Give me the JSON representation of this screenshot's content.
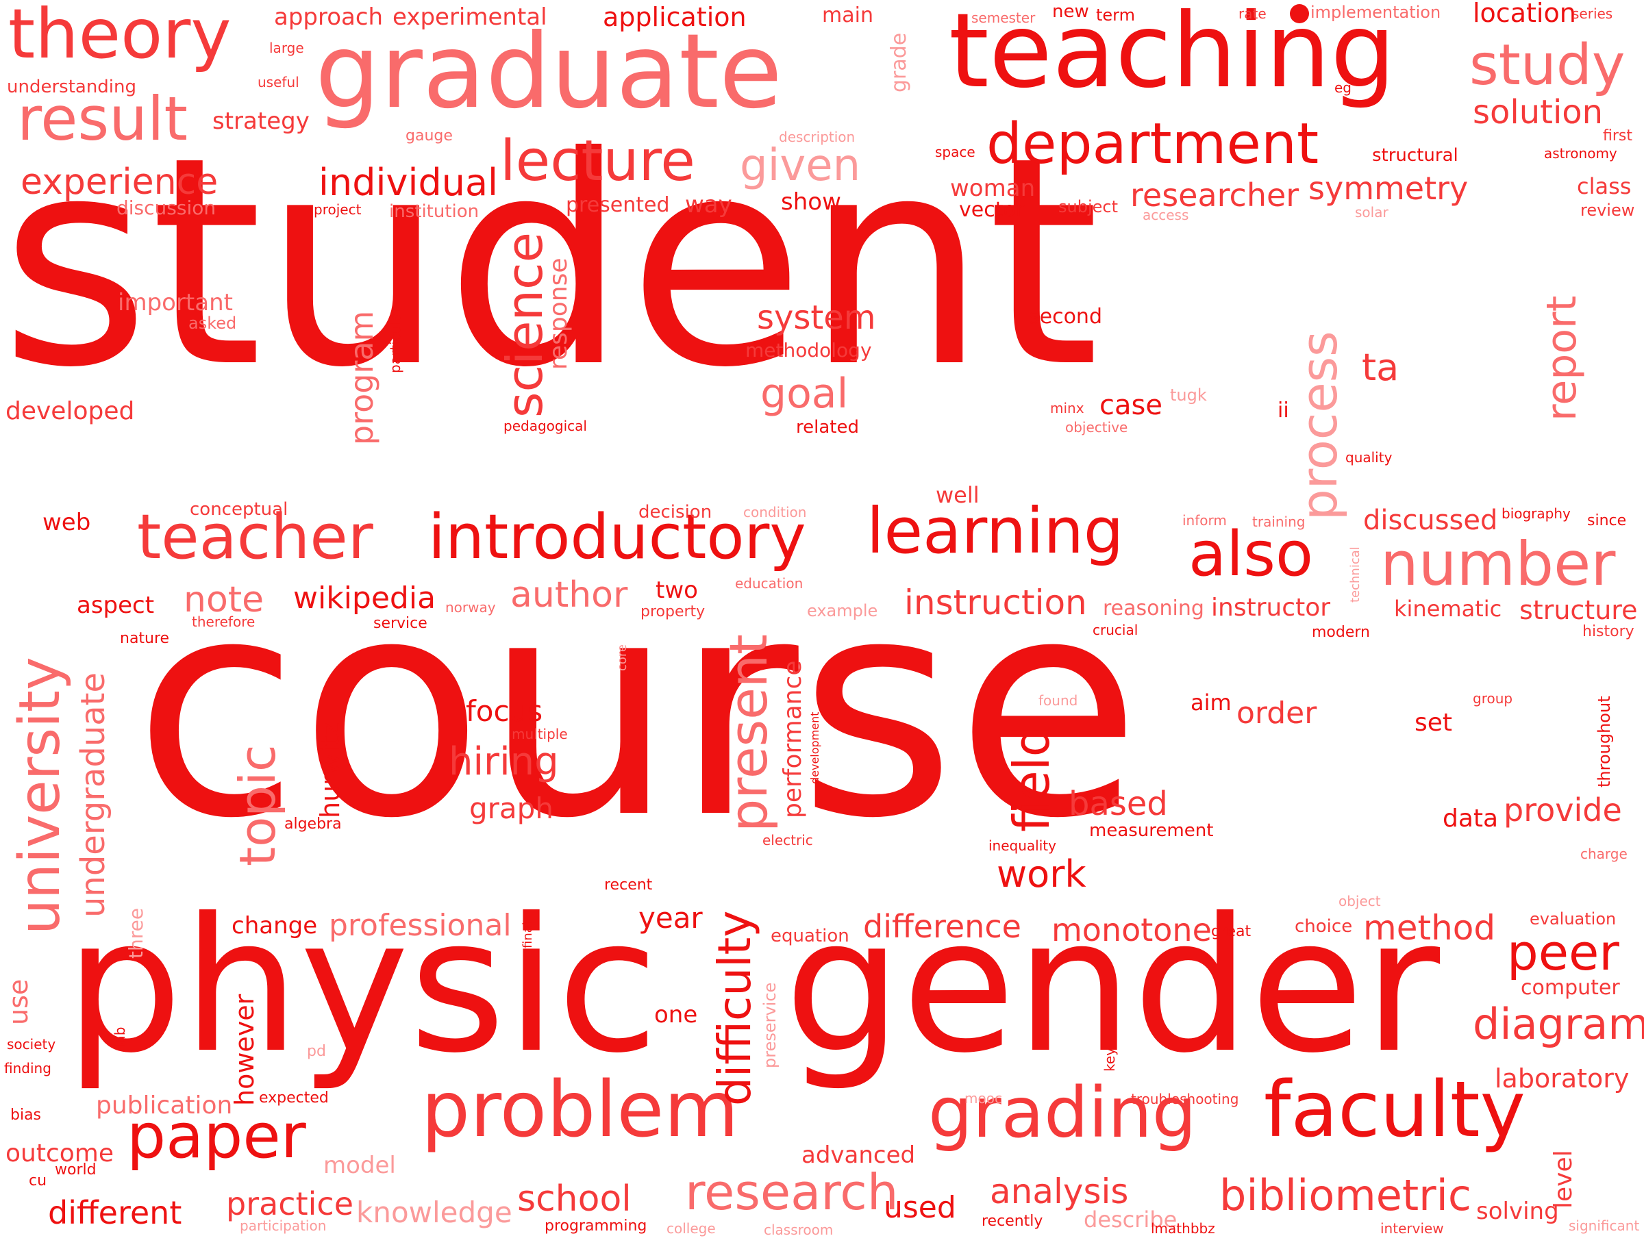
{
  "colors": {
    "strong": "#ee1111",
    "medium": "#f53a3a",
    "light": "#f96b6b",
    "pale": "#fb9a9a",
    "background": "#ffffff"
  },
  "words": [
    {
      "text": "student",
      "weight": 10
    },
    {
      "text": "course",
      "weight": 10
    },
    {
      "text": "physic",
      "weight": 9
    },
    {
      "text": "gender",
      "weight": 9
    },
    {
      "text": "teaching",
      "weight": 8
    },
    {
      "text": "graduate",
      "weight": 8
    },
    {
      "text": "theory",
      "weight": 7
    },
    {
      "text": "result",
      "weight": 6
    },
    {
      "text": "department",
      "weight": 6
    },
    {
      "text": "lecture",
      "weight": 6
    },
    {
      "text": "study",
      "weight": 6
    },
    {
      "text": "teacher",
      "weight": 6
    },
    {
      "text": "introductory",
      "weight": 6
    },
    {
      "text": "learning",
      "weight": 6
    },
    {
      "text": "also",
      "weight": 6
    },
    {
      "text": "number",
      "weight": 6
    },
    {
      "text": "problem",
      "weight": 6
    },
    {
      "text": "grading",
      "weight": 6
    },
    {
      "text": "faculty",
      "weight": 6
    },
    {
      "text": "paper",
      "weight": 6
    },
    {
      "text": "research",
      "weight": 5
    },
    {
      "text": "university",
      "weight": 5
    },
    {
      "text": "science",
      "weight": 5
    },
    {
      "text": "process",
      "weight": 5
    },
    {
      "text": "present",
      "weight": 5
    },
    {
      "text": "topic",
      "weight": 5
    },
    {
      "text": "field",
      "weight": 5
    },
    {
      "text": "difficulty",
      "weight": 5
    },
    {
      "text": "peer",
      "weight": 5
    },
    {
      "text": "diagram",
      "weight": 4
    },
    {
      "text": "bibliometric",
      "weight": 4
    },
    {
      "text": "report",
      "weight": 4
    },
    {
      "text": "given",
      "weight": 4
    },
    {
      "text": "individual",
      "weight": 4
    },
    {
      "text": "experience",
      "weight": 4
    },
    {
      "text": "solution",
      "weight": 4
    },
    {
      "text": "researcher",
      "weight": 4
    },
    {
      "text": "symmetry",
      "weight": 4
    },
    {
      "text": "system",
      "weight": 4
    },
    {
      "text": "goal",
      "weight": 4
    },
    {
      "text": "instruction",
      "weight": 4
    },
    {
      "text": "author",
      "weight": 4
    },
    {
      "text": "note",
      "weight": 4
    },
    {
      "text": "wikipedia",
      "weight": 4
    },
    {
      "text": "hiring",
      "weight": 4
    },
    {
      "text": "focus",
      "weight": 4
    },
    {
      "text": "graph",
      "weight": 4
    },
    {
      "text": "order",
      "weight": 4
    },
    {
      "text": "based",
      "weight": 4
    },
    {
      "text": "work",
      "weight": 4
    },
    {
      "text": "provide",
      "weight": 4
    },
    {
      "text": "method",
      "weight": 4
    },
    {
      "text": "monotone",
      "weight": 4
    },
    {
      "text": "difference",
      "weight": 4
    },
    {
      "text": "professional",
      "weight": 4
    },
    {
      "text": "analysis",
      "weight": 4
    },
    {
      "text": "school",
      "weight": 4
    },
    {
      "text": "practice",
      "weight": 4
    },
    {
      "text": "different",
      "weight": 4
    },
    {
      "text": "knowledge",
      "weight": 4
    },
    {
      "text": "undergraduate",
      "weight": 4
    },
    {
      "text": "program",
      "weight": 4
    },
    {
      "text": "location",
      "weight": 3
    },
    {
      "text": "discussed",
      "weight": 3
    },
    {
      "text": "structure",
      "weight": 3
    },
    {
      "text": "laboratory",
      "weight": 3
    },
    {
      "text": "used",
      "weight": 3
    },
    {
      "text": "outcome",
      "weight": 3
    },
    {
      "text": "publication",
      "weight": 3
    },
    {
      "text": "however",
      "weight": 3
    },
    {
      "text": "approach",
      "weight": 3
    },
    {
      "text": "experimental",
      "weight": 3
    },
    {
      "text": "application",
      "weight": 3
    },
    {
      "text": "strategy",
      "weight": 3
    },
    {
      "text": "important",
      "weight": 3
    },
    {
      "text": "developed",
      "weight": 3
    },
    {
      "text": "response",
      "weight": 3
    },
    {
      "text": "performance",
      "weight": 3
    },
    {
      "text": "instructor",
      "weight": 3
    },
    {
      "text": "reasoning",
      "weight": 3
    },
    {
      "text": "kinematic",
      "weight": 3
    },
    {
      "text": "hurwitz",
      "weight": 3
    },
    {
      "text": "case",
      "weight": 3
    },
    {
      "text": "ta",
      "weight": 3
    },
    {
      "text": "set",
      "weight": 3
    },
    {
      "text": "aim",
      "weight": 3
    },
    {
      "text": "data",
      "weight": 3
    },
    {
      "text": "computer",
      "weight": 3
    },
    {
      "text": "year",
      "weight": 3
    },
    {
      "text": "change",
      "weight": 3
    },
    {
      "text": "one",
      "weight": 3
    },
    {
      "text": "two",
      "weight": 3
    },
    {
      "text": "advanced",
      "weight": 3
    },
    {
      "text": "model",
      "weight": 3
    },
    {
      "text": "class",
      "weight": 3
    },
    {
      "text": "woman",
      "weight": 3
    },
    {
      "text": "show",
      "weight": 3
    },
    {
      "text": "way",
      "weight": 3
    },
    {
      "text": "presented",
      "weight": 3
    },
    {
      "text": "vector",
      "weight": 3
    },
    {
      "text": "second",
      "weight": 3
    },
    {
      "text": "well",
      "weight": 3
    },
    {
      "text": "web",
      "weight": 3
    },
    {
      "text": "aspect",
      "weight": 3
    },
    {
      "text": "measurement",
      "weight": 2
    },
    {
      "text": "solving",
      "weight": 3
    },
    {
      "text": "level",
      "weight": 3
    },
    {
      "text": "describe",
      "weight": 3
    },
    {
      "text": "use",
      "weight": 3
    },
    {
      "text": "main",
      "weight": 3
    },
    {
      "text": "grade",
      "weight": 3
    },
    {
      "text": "new",
      "weight": 2
    },
    {
      "text": "term",
      "weight": 2
    },
    {
      "text": "rate",
      "weight": 2
    },
    {
      "text": "implementation",
      "weight": 2
    },
    {
      "text": "series",
      "weight": 2
    },
    {
      "text": "semester",
      "weight": 2
    },
    {
      "text": "large",
      "weight": 2
    },
    {
      "text": "useful",
      "weight": 2
    },
    {
      "text": "understanding",
      "weight": 2
    },
    {
      "text": "gauge",
      "weight": 2
    },
    {
      "text": "description",
      "weight": 2
    },
    {
      "text": "eg",
      "weight": 2
    },
    {
      "text": "first",
      "weight": 2
    },
    {
      "text": "astronomy",
      "weight": 2
    },
    {
      "text": "structural",
      "weight": 2
    },
    {
      "text": "space",
      "weight": 2
    },
    {
      "text": "discussion",
      "weight": 2
    },
    {
      "text": "project",
      "weight": 2
    },
    {
      "text": "institution",
      "weight": 2
    },
    {
      "text": "subject",
      "weight": 2
    },
    {
      "text": "access",
      "weight": 2
    },
    {
      "text": "solar",
      "weight": 2
    },
    {
      "text": "review",
      "weight": 2
    },
    {
      "text": "asked",
      "weight": 2
    },
    {
      "text": "methodology",
      "weight": 2
    },
    {
      "text": "particular",
      "weight": 2
    },
    {
      "text": "pedagogical",
      "weight": 2
    },
    {
      "text": "related",
      "weight": 2
    },
    {
      "text": "minx",
      "weight": 2
    },
    {
      "text": "objective",
      "weight": 2
    },
    {
      "text": "tugk",
      "weight": 2
    },
    {
      "text": "ii",
      "weight": 2
    },
    {
      "text": "quality",
      "weight": 2
    },
    {
      "text": "conceptual",
      "weight": 2
    },
    {
      "text": "decision",
      "weight": 2
    },
    {
      "text": "condition",
      "weight": 2
    },
    {
      "text": "inform",
      "weight": 2
    },
    {
      "text": "training",
      "weight": 2
    },
    {
      "text": "technical",
      "weight": 2
    },
    {
      "text": "biography",
      "weight": 2
    },
    {
      "text": "since",
      "weight": 2
    },
    {
      "text": "education",
      "weight": 2
    },
    {
      "text": "property",
      "weight": 2
    },
    {
      "text": "example",
      "weight": 2
    },
    {
      "text": "norway",
      "weight": 2
    },
    {
      "text": "crucial",
      "weight": 2
    },
    {
      "text": "modern",
      "weight": 2
    },
    {
      "text": "history",
      "weight": 2
    },
    {
      "text": "therefore",
      "weight": 2
    },
    {
      "text": "service",
      "weight": 2
    },
    {
      "text": "nature",
      "weight": 2
    },
    {
      "text": "core",
      "weight": 2
    },
    {
      "text": "found",
      "weight": 2
    },
    {
      "text": "group",
      "weight": 2
    },
    {
      "text": "multiple",
      "weight": 2
    },
    {
      "text": "development",
      "weight": 2
    },
    {
      "text": "throughout",
      "weight": 2
    },
    {
      "text": "algebra",
      "weight": 2
    },
    {
      "text": "electric",
      "weight": 2
    },
    {
      "text": "inequality",
      "weight": 2
    },
    {
      "text": "charge",
      "weight": 2
    },
    {
      "text": "recent",
      "weight": 2
    },
    {
      "text": "object",
      "weight": 2
    },
    {
      "text": "evaluation",
      "weight": 2
    },
    {
      "text": "choice",
      "weight": 2
    },
    {
      "text": "great",
      "weight": 2
    },
    {
      "text": "equation",
      "weight": 2
    },
    {
      "text": "final",
      "weight": 2
    },
    {
      "text": "three",
      "weight": 2
    },
    {
      "text": "preservice",
      "weight": 2
    },
    {
      "text": "lab",
      "weight": 2
    },
    {
      "text": "society",
      "weight": 2
    },
    {
      "text": "finding",
      "weight": 2
    },
    {
      "text": "pd",
      "weight": 2
    },
    {
      "text": "key",
      "weight": 2
    },
    {
      "text": "mooc",
      "weight": 2
    },
    {
      "text": "troubleshooting",
      "weight": 2
    },
    {
      "text": "expected",
      "weight": 2
    },
    {
      "text": "bias",
      "weight": 2
    },
    {
      "text": "world",
      "weight": 2
    },
    {
      "text": "cu",
      "weight": 2
    },
    {
      "text": "participation",
      "weight": 2
    },
    {
      "text": "programming",
      "weight": 2
    },
    {
      "text": "college",
      "weight": 2
    },
    {
      "text": "classroom",
      "weight": 2
    },
    {
      "text": "recently",
      "weight": 2
    },
    {
      "text": "lmathbbz",
      "weight": 2
    },
    {
      "text": "interview",
      "weight": 2
    },
    {
      "text": "significant",
      "weight": 2
    }
  ]
}
